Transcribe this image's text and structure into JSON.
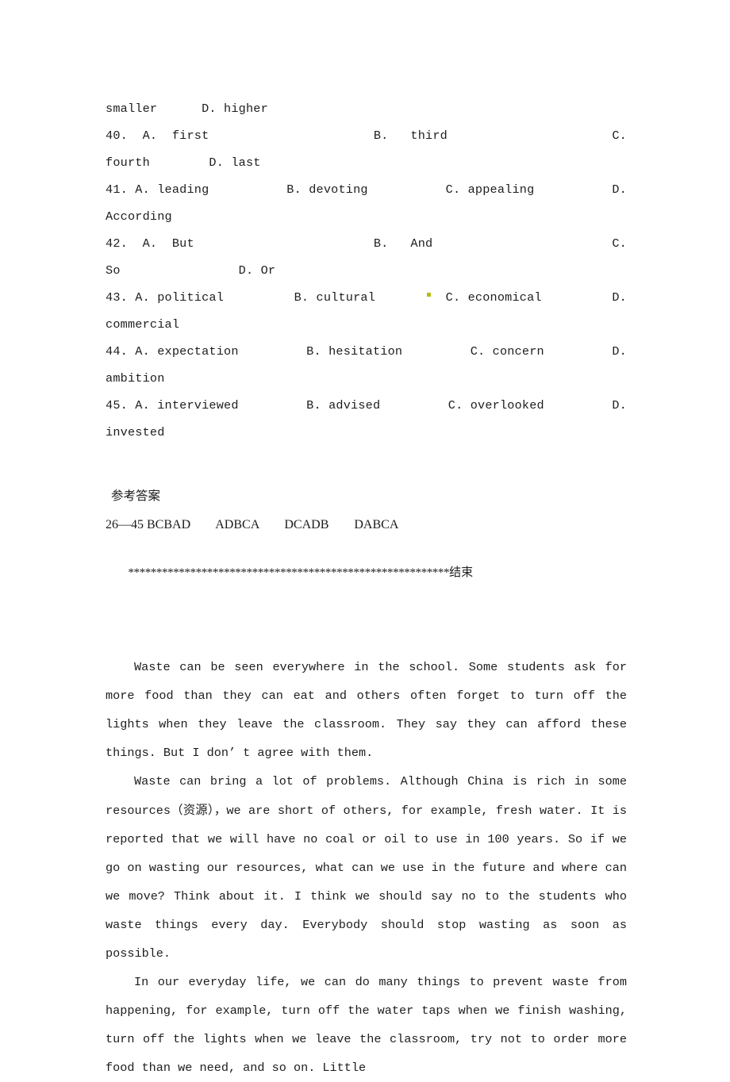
{
  "document": {
    "type": "scanned-exam-worksheet",
    "background_color": "#ffffff",
    "text_color": "#1d1d1d"
  },
  "mcq_section": {
    "lines": [
      {
        "id": "q39-continuation",
        "justified": false,
        "text": "smaller      D. higher"
      },
      {
        "id": "q40-line1",
        "justified": true,
        "left": "40.  A.  first",
        "middle": "B.   third",
        "right": "C."
      },
      {
        "id": "q40-line2",
        "justified": false,
        "text": "fourth        D. last"
      },
      {
        "id": "q41-line1",
        "justified": true,
        "left": "41. A. leading",
        "middle": "B. devoting",
        "right2": "C. appealing",
        "right": "D."
      },
      {
        "id": "q41-line2",
        "justified": false,
        "text": "According"
      },
      {
        "id": "q42-line1",
        "justified": true,
        "left": "42.  A.  But",
        "middle": "B.   And",
        "right": "C."
      },
      {
        "id": "q42-line2",
        "justified": false,
        "text": "So                D. Or"
      },
      {
        "id": "q43-line1",
        "justified": true,
        "left": "43. A. political",
        "middle": "B. cultural",
        "right2": "C. economical",
        "right": "D."
      },
      {
        "id": "q43-line2",
        "justified": false,
        "text": "commercial"
      },
      {
        "id": "q44-line1",
        "justified": true,
        "left": "44. A. expectation",
        "middle": "B. hesitation",
        "right2": "C. concern",
        "right": "D."
      },
      {
        "id": "q44-line2",
        "justified": false,
        "text": "ambition"
      },
      {
        "id": "q45-line1",
        "justified": true,
        "left": "45. A. interviewed",
        "middle": "B. advised",
        "right2": "C. overlooked",
        "right": "D."
      },
      {
        "id": "q45-line2",
        "justified": false,
        "text": "invested"
      }
    ]
  },
  "answers_section": {
    "heading": "参考答案",
    "key_line": "26—45 BCBAD        ADBCA        DCADB        DABCA",
    "separator_stars": "*********************************************************",
    "separator_end_label": "结束"
  },
  "essay": {
    "paragraphs": [
      {
        "id": "para-1",
        "text": "Waste can be seen everywhere in the school. Some students ask for more food than they can eat and others often forget to turn off the lights when they leave the classroom. They say they can afford these things. But I don’ t agree with them."
      },
      {
        "id": "para-2",
        "part_a": "Waste can bring a lot of problems. Although China is rich in some resources",
        "cjk_note": "（资源）",
        "part_b": "，we are short of others, for example, fresh water. It is reported that we will have no coal or oil to use in 100 years. So if we go on wasting our resources, what can we use in the future and where can we move? Think about it. I think we should say no to the students who waste things every day. Everybody should stop wasting as soon as possible."
      },
      {
        "id": "para-3",
        "text": "In our everyday life, we can do many things to prevent waste from happening,  for example, turn off the water taps when we finish washing, turn off the lights when we leave the classroom, try not to order more food than we need, and so on. Little"
      }
    ]
  },
  "artifacts": {
    "yellow_dot_color": "#b5bb18"
  }
}
